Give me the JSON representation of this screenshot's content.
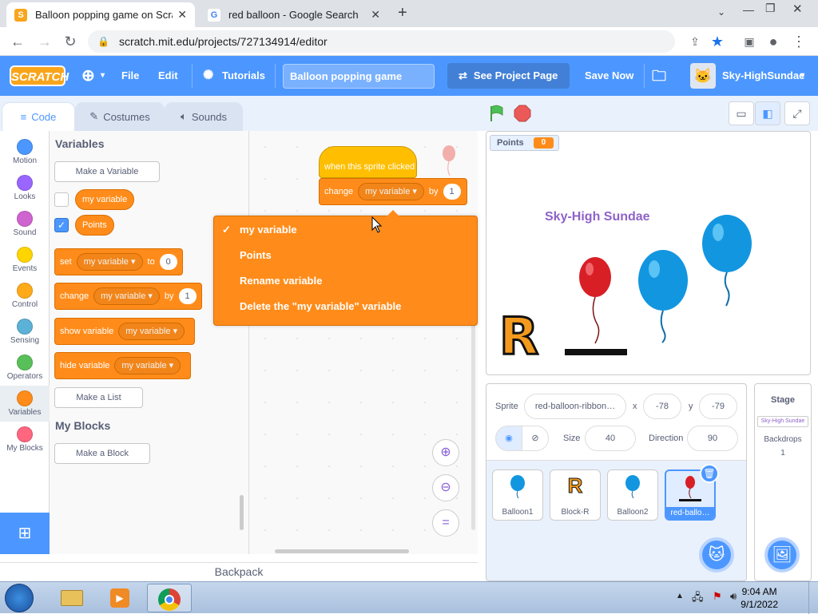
{
  "browser": {
    "tabs": [
      {
        "title": "Balloon popping game on Scratc",
        "active": true
      },
      {
        "title": "red balloon - Google Search",
        "active": false
      }
    ],
    "new_tab": "+",
    "url": "scratch.mit.edu/projects/727134914/editor"
  },
  "menubar": {
    "logo": "SCRATCH",
    "file": "File",
    "edit": "Edit",
    "tutorials": "Tutorials",
    "project_title": "Balloon popping game",
    "see_project": "See Project Page",
    "save_now": "Save Now",
    "username": "Sky-HighSundae",
    "colors": {
      "bar": "#4c97ff"
    }
  },
  "editor_tabs": {
    "code": "Code",
    "costumes": "Costumes",
    "sounds": "Sounds"
  },
  "categories": [
    {
      "label": "Motion",
      "color": "#4c97ff"
    },
    {
      "label": "Looks",
      "color": "#9966ff"
    },
    {
      "label": "Sound",
      "color": "#cf63cf"
    },
    {
      "label": "Events",
      "color": "#ffd500"
    },
    {
      "label": "Control",
      "color": "#ffab19"
    },
    {
      "label": "Sensing",
      "color": "#5cb1d6"
    },
    {
      "label": "Operators",
      "color": "#59c059"
    },
    {
      "label": "Variables",
      "color": "#ff8c1a"
    },
    {
      "label": "My Blocks",
      "color": "#ff6680"
    }
  ],
  "palette": {
    "variables_heading": "Variables",
    "make_variable": "Make a Variable",
    "var1": "my variable",
    "var2": "Points",
    "set_block": {
      "label": "set",
      "var": "my variable",
      "to": "to",
      "value": "0"
    },
    "change_block": {
      "label": "change",
      "var": "my variable",
      "by": "by",
      "value": "1"
    },
    "show_block": {
      "label": "show variable",
      "var": "my variable"
    },
    "hide_block": {
      "label": "hide variable",
      "var": "my variable"
    },
    "make_list": "Make a List",
    "myblocks_heading": "My Blocks",
    "make_block": "Make a Block"
  },
  "script": {
    "hat_label": "when this sprite clicked",
    "change_label": "change",
    "change_var": "my variable",
    "change_by": "by",
    "change_value": "1"
  },
  "dropdown": {
    "check": "✓",
    "items": [
      "my variable",
      "Points",
      "Rename variable",
      "Delete the \"my variable\" variable"
    ]
  },
  "backpack": "Backpack",
  "stage": {
    "monitor_label": "Points",
    "monitor_value": "0",
    "brand_text": "Sky-High Sundae",
    "letter": "R"
  },
  "sprite_info": {
    "sprite_label": "Sprite",
    "sprite_name": "red-balloon-ribbon…",
    "x_label": "x",
    "x_value": "-78",
    "y_label": "y",
    "y_value": "-79",
    "show_label": "Show",
    "size_label": "Size",
    "size_value": "40",
    "direction_label": "Direction",
    "direction_value": "90"
  },
  "sprites": [
    {
      "name": "Balloon1"
    },
    {
      "name": "Block-R"
    },
    {
      "name": "Balloon2"
    },
    {
      "name": "red-ballo…"
    }
  ],
  "stage_panel": {
    "title": "Stage",
    "thumb_text": "Sky-High Sundae",
    "backdrops_label": "Backdrops",
    "backdrops_count": "1"
  },
  "taskbar": {
    "time": "9:04 AM",
    "date": "9/1/2022"
  }
}
